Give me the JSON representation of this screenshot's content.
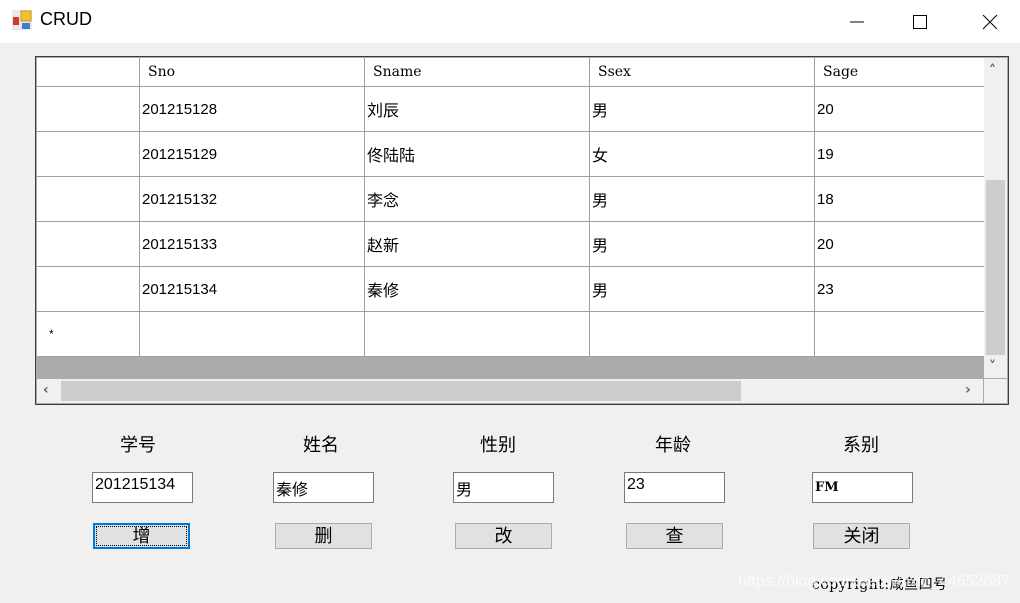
{
  "window": {
    "title": "CRUD",
    "controls": {
      "minimize": "minimize",
      "maximize": "maximize",
      "close": "close"
    }
  },
  "grid": {
    "columns": [
      "Sno",
      "Sname",
      "Ssex",
      "Sage"
    ],
    "rows": [
      {
        "Sno": "201215128",
        "Sname": "刘辰",
        "Ssex": "男",
        "Sage": "20"
      },
      {
        "Sno": "201215129",
        "Sname": "佟陆陆",
        "Ssex": "女",
        "Sage": "19"
      },
      {
        "Sno": "201215132",
        "Sname": "李念",
        "Ssex": "男",
        "Sage": "18"
      },
      {
        "Sno": "201215133",
        "Sname": "赵新",
        "Ssex": "男",
        "Sage": "20"
      },
      {
        "Sno": "201215134",
        "Sname": "秦修",
        "Ssex": "男",
        "Sage": "23"
      }
    ],
    "new_row_marker": "*"
  },
  "form": {
    "labels": {
      "sno": "学号",
      "sname": "姓名",
      "ssex": "性别",
      "sage": "年龄",
      "sdept": "系别"
    },
    "values": {
      "sno": "201215134",
      "sname": "秦修",
      "ssex": "男",
      "sage": "23",
      "sdept": "FM"
    }
  },
  "buttons": {
    "add": "增",
    "delete": "删",
    "update": "改",
    "query": "查",
    "close": "关闭"
  },
  "footer": {
    "copyright": "copyright:咸鱼四号",
    "watermark": "https://blog.csdn.net/weixin_44652687"
  }
}
